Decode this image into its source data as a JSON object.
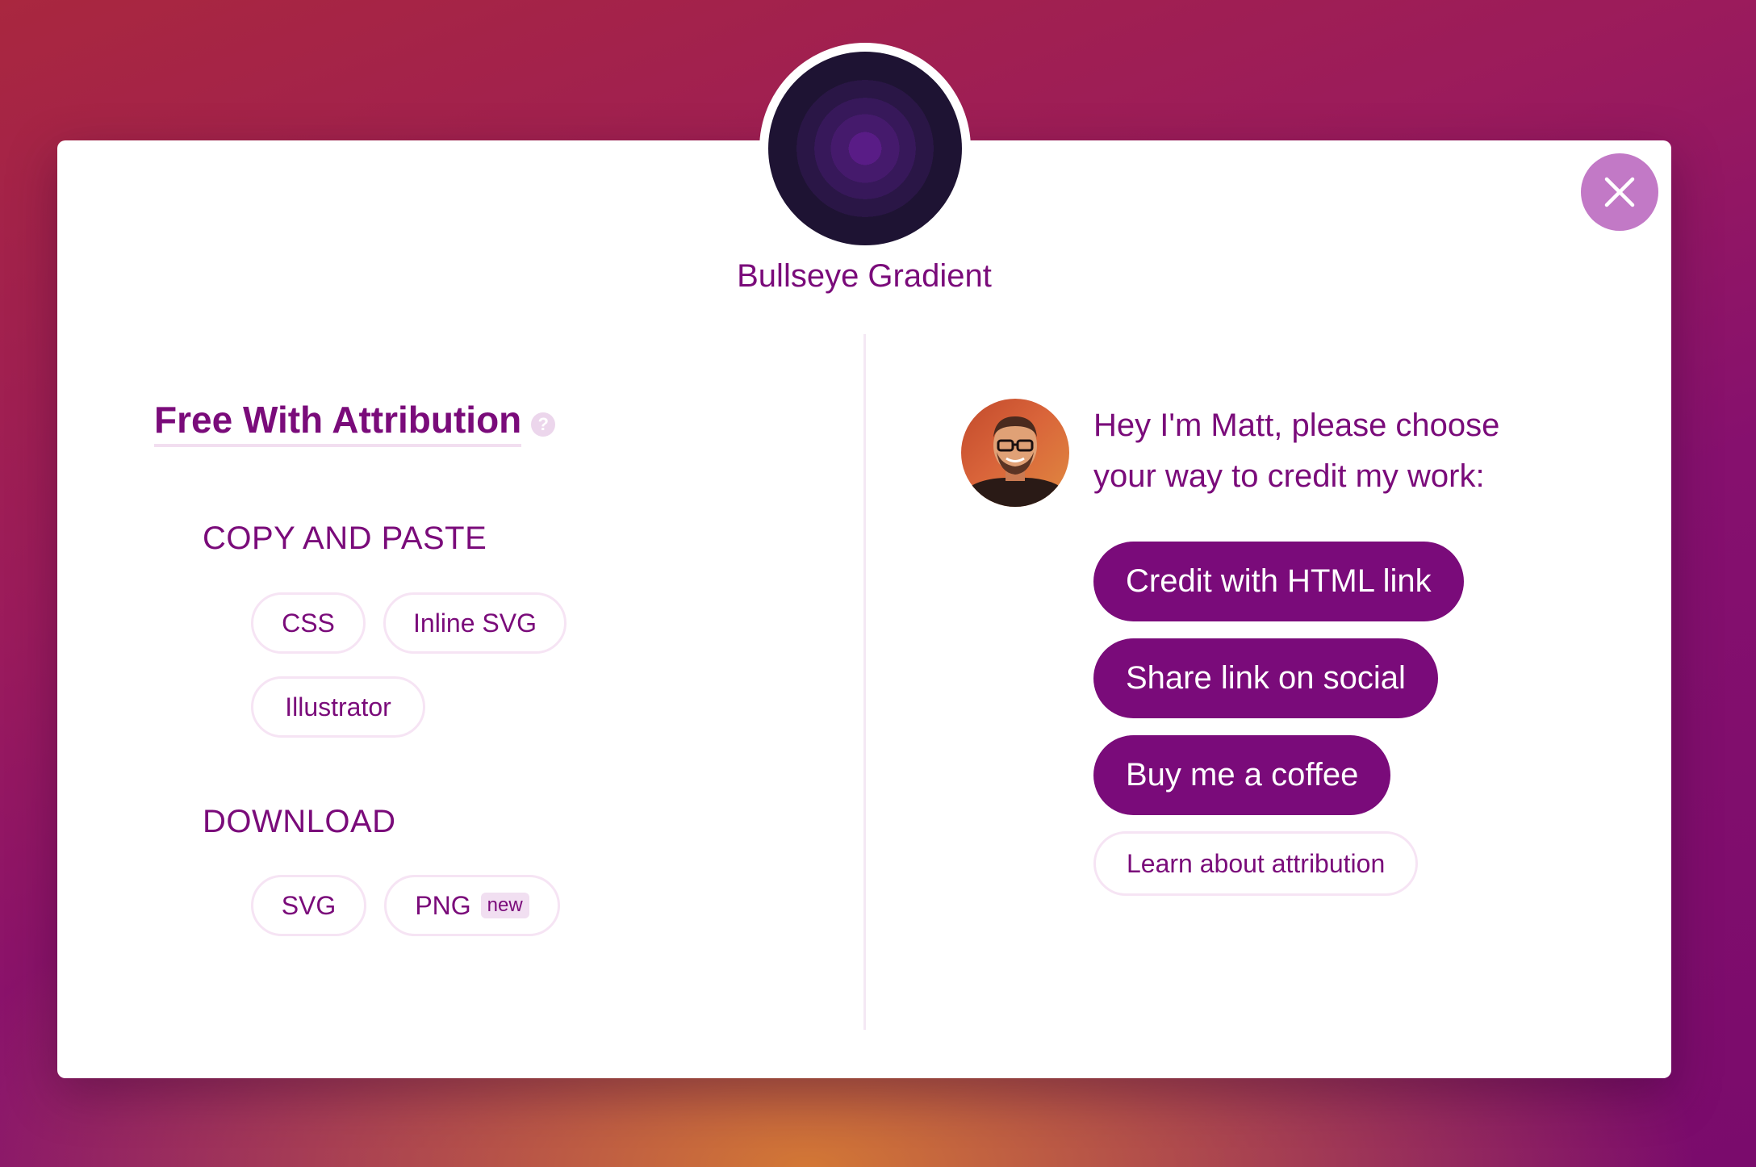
{
  "modal": {
    "title": "Bullseye Gradient",
    "close_icon": "close-icon"
  },
  "left": {
    "heading": "Free With Attribution",
    "help_icon_glyph": "?",
    "copy_paste": {
      "title": "COPY AND PASTE",
      "buttons": [
        "CSS",
        "Inline SVG",
        "Illustrator"
      ]
    },
    "download": {
      "title": "DOWNLOAD",
      "buttons": [
        "SVG",
        "PNG"
      ],
      "badge": "new"
    }
  },
  "right": {
    "intro": "Hey I'm Matt, please choose your way to credit my work:",
    "actions": [
      "Credit with HTML link",
      "Share link on social",
      "Buy me a coffee"
    ],
    "learn": "Learn about attribution"
  },
  "colors": {
    "accent": "#7a0b7a",
    "close_button": "#c279c6",
    "bullseye": [
      "#591c86",
      "#451a6c",
      "#37185a",
      "#2a1646",
      "#1e1333"
    ]
  }
}
